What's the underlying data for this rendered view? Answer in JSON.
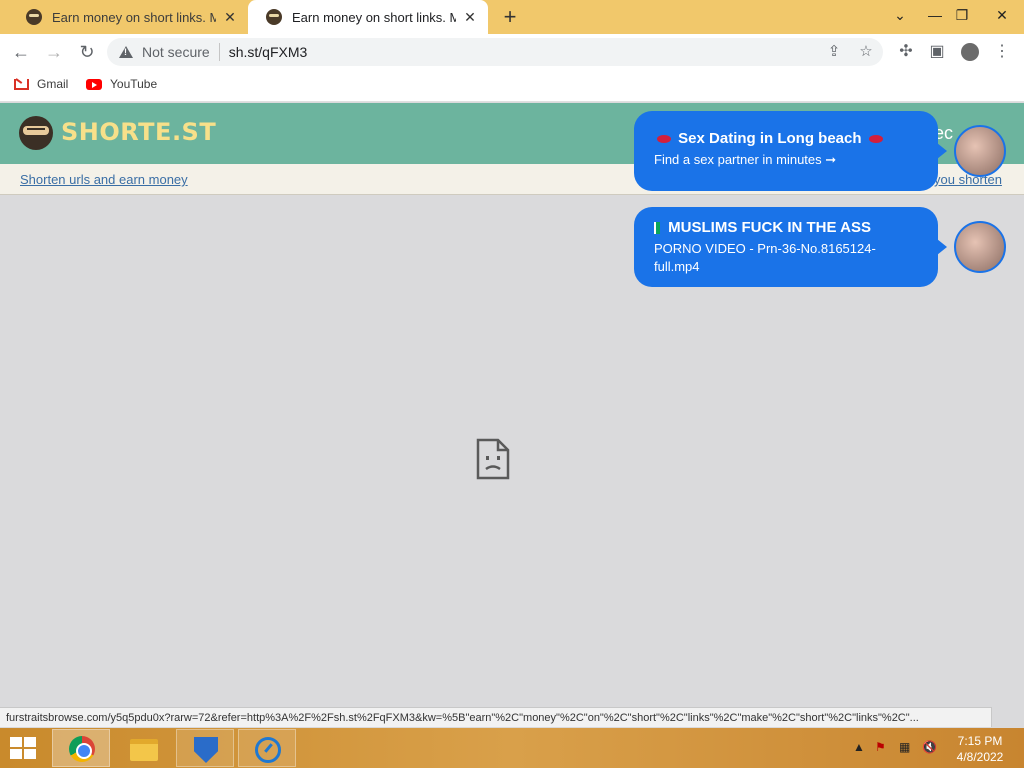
{
  "browser": {
    "tabs": [
      {
        "title": "Earn money on short links. Make",
        "active": false
      },
      {
        "title": "Earn money on short links. Make",
        "active": true
      }
    ],
    "new_tab_symbol": "+",
    "close_symbol": "✕",
    "security_label": "Not secure",
    "url": "sh.st/qFXM3",
    "bookmarks": [
      {
        "label": "Gmail",
        "icon": "gmail-icon"
      },
      {
        "label": "YouTube",
        "icon": "youtube-icon"
      }
    ]
  },
  "site": {
    "logo_text": "SHORTE.ST",
    "header_right_partial": "iec",
    "subbar_left_link": "Shorten urls and earn money",
    "subbar_right_link": "you shorten"
  },
  "notifications": [
    {
      "title": "Sex Dating in Long beach",
      "body": "Find a sex partner in minutes ➞"
    },
    {
      "title": "MUSLIMS FUCK IN THE ASS",
      "body": "PORNO VIDEO - Prn-36-No.8165124-full.mp4"
    }
  ],
  "status_bar": {
    "text": "furstraitsbrowse.com/y5q5pdu0x?rarw=72&refer=http%3A%2F%2Fsh.st%2FqFXM3&kw=%5B\"earn\"%2C\"money\"%2C\"on\"%2C\"short\"%2C\"links\"%2C\"make\"%2C\"short\"%2C\"links\"%2C\"..."
  },
  "taskbar": {
    "apps": [
      "chrome-icon",
      "file-explorer-icon",
      "shield-app-icon",
      "speedometer-icon"
    ],
    "time": "7:15 PM",
    "date": "4/8/2022"
  },
  "colors": {
    "tab_strip": "#f1c86b",
    "site_header": "#6cb49e",
    "notification": "#1a73e8",
    "page_background": "#dadadc"
  }
}
